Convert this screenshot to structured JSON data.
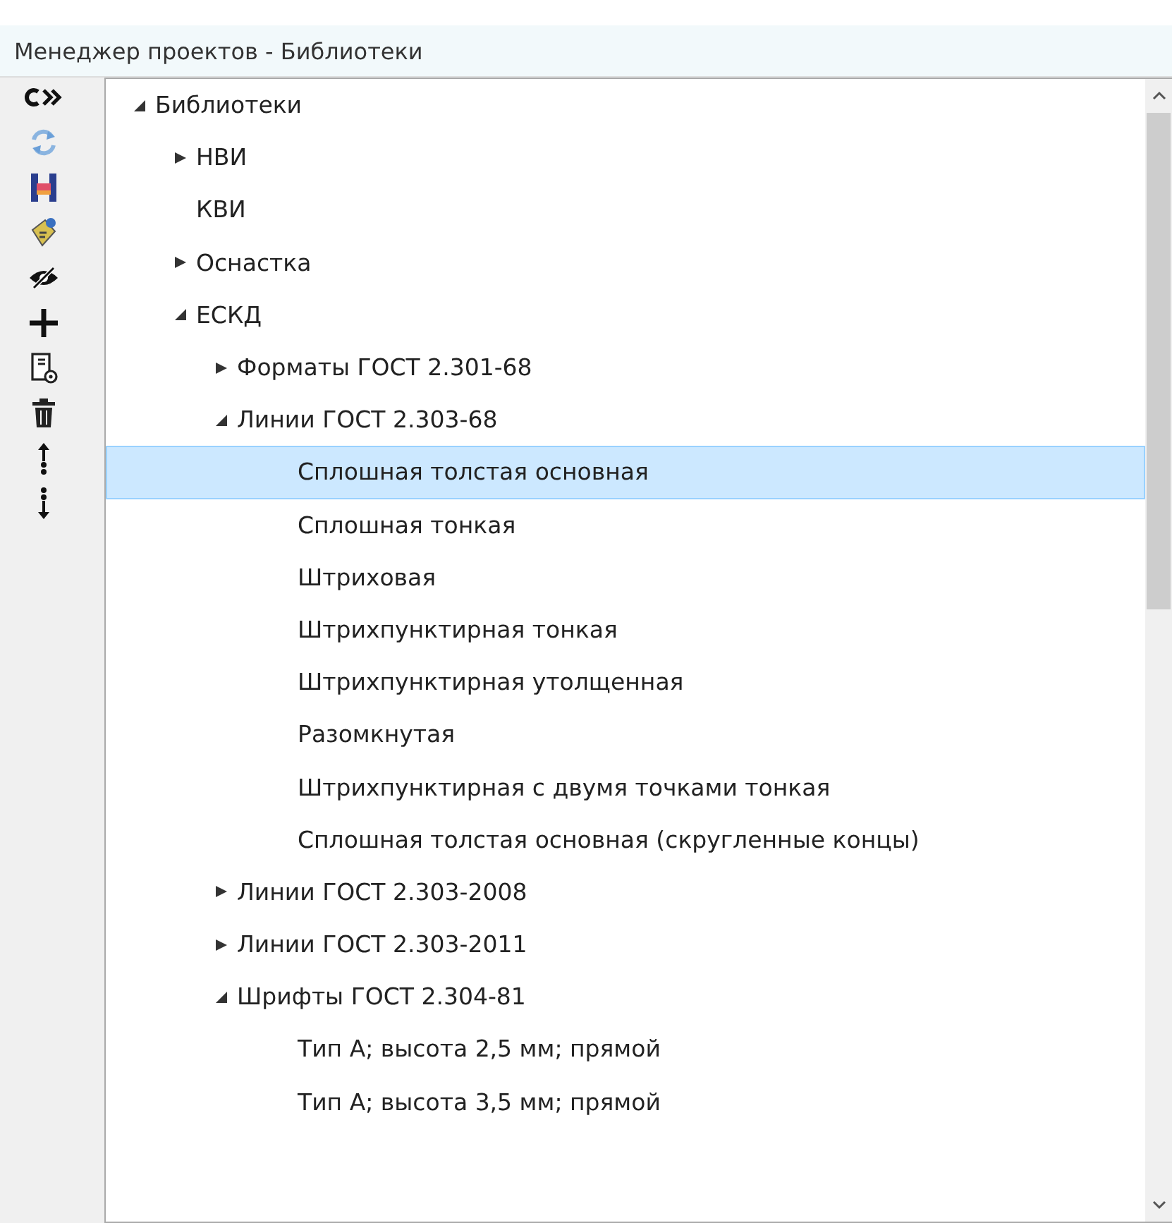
{
  "window": {
    "title": "Менеджер проектов - Библиотеки"
  },
  "toolbar": [
    {
      "kind": "refresh"
    },
    {
      "kind": "sync"
    },
    {
      "kind": "save"
    },
    {
      "kind": "tag"
    },
    {
      "kind": "hide"
    },
    {
      "kind": "add"
    },
    {
      "kind": "properties"
    },
    {
      "kind": "delete"
    },
    {
      "kind": "moveup"
    },
    {
      "kind": "movedown"
    }
  ],
  "tree": [
    {
      "label": "Библиотеки",
      "expanded": true,
      "selected": false,
      "children": [
        {
          "label": "НВИ",
          "expanded": false,
          "selected": false
        },
        {
          "label": "КВИ",
          "selected": false
        },
        {
          "label": "Оснастка",
          "expanded": false,
          "selected": false
        },
        {
          "label": "ЕСКД",
          "expanded": true,
          "selected": false,
          "children": [
            {
              "label": "Форматы ГОСТ 2.301-68",
              "expanded": false,
              "selected": false
            },
            {
              "label": "Линии ГОСТ 2.303-68",
              "expanded": true,
              "selected": false,
              "children": [
                {
                  "label": "Сплошная толстая основная",
                  "selected": true
                },
                {
                  "label": "Сплошная тонкая",
                  "selected": false
                },
                {
                  "label": "Штриховая",
                  "selected": false
                },
                {
                  "label": "Штрихпунктирная тонкая",
                  "selected": false
                },
                {
                  "label": "Штрихпунктирная утолщенная",
                  "selected": false
                },
                {
                  "label": "Разомкнутая",
                  "selected": false
                },
                {
                  "label": "Штрихпунктирная с двумя точками тонкая",
                  "selected": false
                },
                {
                  "label": "Сплошная толстая основная (скругленные концы)",
                  "selected": false
                }
              ]
            },
            {
              "label": "Линии ГОСТ 2.303-2008",
              "expanded": false,
              "selected": false
            },
            {
              "label": "Линии ГОСТ 2.303-2011",
              "expanded": false,
              "selected": false
            },
            {
              "label": "Шрифты ГОСТ 2.304-81",
              "expanded": true,
              "selected": false,
              "children": [
                {
                  "label": "Тип А; высота 2,5 мм; прямой",
                  "selected": false
                },
                {
                  "label": "Тип А; высота 3,5 мм; прямой",
                  "selected": false
                }
              ]
            }
          ]
        }
      ]
    }
  ]
}
